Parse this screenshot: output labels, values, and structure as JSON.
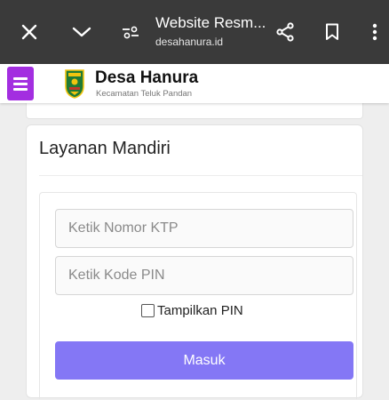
{
  "browser": {
    "page_title": "Website Resm...",
    "host": "desahanura.id"
  },
  "site": {
    "name": "Desa Hanura",
    "subtitle": "Kecamatan Teluk Pandan",
    "brand_color": "#a32ee0"
  },
  "icons": {
    "close": "close-icon",
    "collapse": "chevron-down-icon",
    "page_settings": "page-settings-icon",
    "share": "share-icon",
    "bookmark": "bookmark-icon",
    "more": "more-vertical-icon",
    "menu": "hamburger-menu-icon",
    "crest": "village-crest-icon"
  },
  "login": {
    "title": "Layanan Mandiri",
    "ktp_placeholder": "Ketik Nomor KTP",
    "pin_placeholder": "Ketik Kode PIN",
    "show_pin_label": "Tampilkan PIN",
    "show_pin_checked": false,
    "submit_label": "Masuk",
    "button_color": "#8477f5"
  }
}
